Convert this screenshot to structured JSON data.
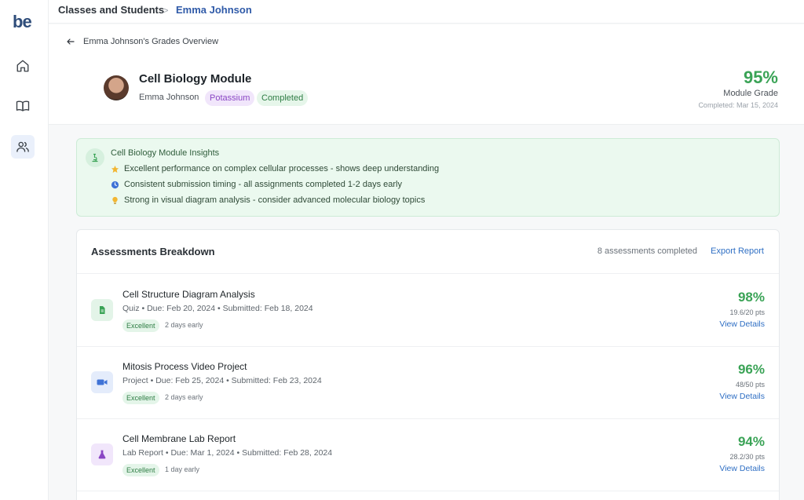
{
  "brand": {
    "logo_text": "be"
  },
  "sidebar": {
    "items": [
      {
        "icon": "home-icon"
      },
      {
        "icon": "book-icon"
      },
      {
        "icon": "users-icon",
        "active": true
      }
    ]
  },
  "breadcrumb": {
    "root": "Classes and Students",
    "separator": ">",
    "current": "Emma Johnson"
  },
  "header": {
    "back_label": "Emma Johnson's Grades Overview",
    "module_title": "Cell Biology Module",
    "student_name": "Emma Johnson",
    "tags": {
      "potassium": "Potassium",
      "status": "Completed"
    },
    "grade": "95%",
    "grade_label": "Module Grade",
    "completed_date": "Completed: Mar 15, 2024"
  },
  "insights": {
    "title": "Cell Biology Module Insights",
    "items": [
      {
        "icon": "star-icon",
        "text": "Excellent performance on complex cellular processes - shows deep understanding"
      },
      {
        "icon": "clock-icon",
        "text": "Consistent submission timing - all assignments completed 1-2 days early"
      },
      {
        "icon": "lightbulb-icon",
        "text": "Strong in visual diagram analysis - consider advanced molecular biology topics"
      }
    ]
  },
  "assessments": {
    "title": "Assessments Breakdown",
    "count_text": "8 assessments completed",
    "export_label": "Export Report",
    "rows": [
      {
        "icon": "document-icon",
        "title": "Cell Structure Diagram Analysis",
        "meta": "Quiz • Due: Feb 20, 2024 • Submitted: Feb 18, 2024",
        "tag": "Excellent",
        "early": "2 days early",
        "percent": "98%",
        "points": "19.6/20 pts",
        "link": "View Details"
      },
      {
        "icon": "video-icon",
        "title": "Mitosis Process Video Project",
        "meta": "Project • Due: Feb 25, 2024 • Submitted: Feb 23, 2024",
        "tag": "Excellent",
        "early": "2 days early",
        "percent": "96%",
        "points": "48/50 pts",
        "link": "View Details"
      },
      {
        "icon": "flask-icon",
        "title": "Cell Membrane Lab Report",
        "meta": "Lab Report • Due: Mar 1, 2024 • Submitted: Feb 28, 2024",
        "tag": "Excellent",
        "early": "1 day early",
        "percent": "94%",
        "points": "28.2/30 pts",
        "link": "View Details"
      }
    ]
  },
  "colors": {
    "accent_blue": "#2f6fc4",
    "success_green": "#3aa356",
    "potassium_purple": "#8a46c4",
    "insight_bg": "#ebf9ef"
  }
}
